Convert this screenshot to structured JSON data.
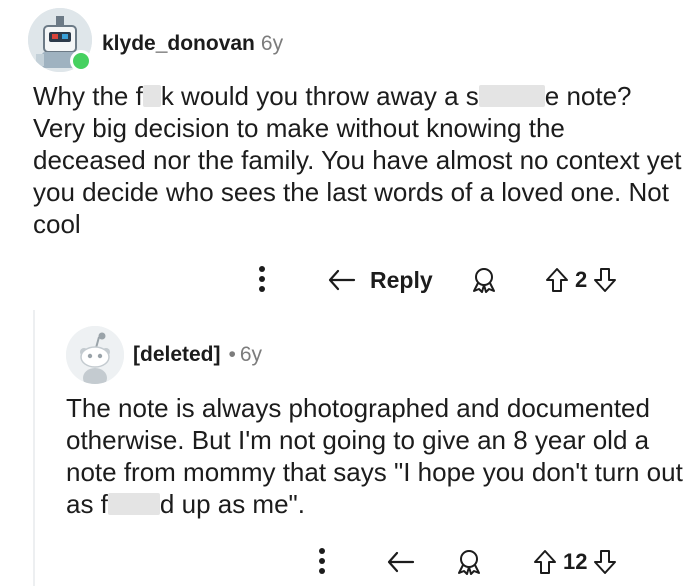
{
  "comment": {
    "username": "klyde_donovan",
    "age": "6y",
    "text_parts": [
      "Why the f",
      "k would you throw away a s",
      "e note? Very big decision to make without knowing the deceased nor the family. You have almost no context yet you decide who sees the last words of a loved one. Not cool"
    ],
    "actions": {
      "reply_label": "Reply",
      "vote_count": "2"
    }
  },
  "reply": {
    "username": "[deleted]",
    "separator": "•",
    "age": "6y",
    "text_parts": [
      "The note is always photographed and documented otherwise. But I'm not going to give an 8 year old a note from mommy that says \"I hope you don't turn out as f",
      "d up as me\"."
    ],
    "actions": {
      "vote_count": "12"
    }
  },
  "colors": {
    "text": "#1c1c1c",
    "muted": "#7c7c7c",
    "online": "#46d160",
    "redaction": "#e4e4e4"
  },
  "icons": [
    "robot-avatar-icon",
    "more-options-icon",
    "reply-arrow-icon",
    "award-icon",
    "upvote-icon",
    "downvote-icon",
    "snoo-avatar-icon"
  ]
}
